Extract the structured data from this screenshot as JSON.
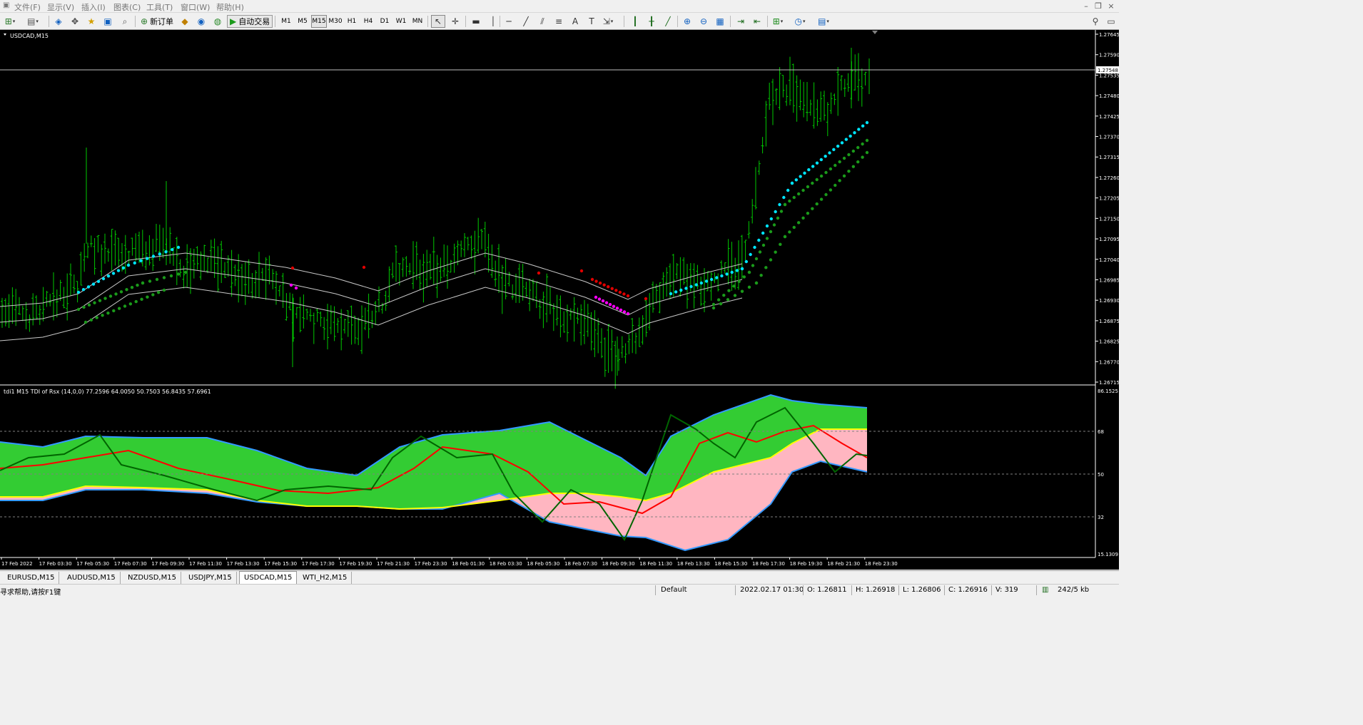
{
  "menu": {
    "items": [
      "文件(F)",
      "显示(V)",
      "图表(C)",
      "插入(I)",
      "工具(T)",
      "窗口(W)",
      "帮助(H)"
    ]
  },
  "toolbar": {
    "new_order_label": "新订单",
    "auto_trading_label": "自动交易",
    "timeframes": [
      "M1",
      "M5",
      "M15",
      "M30",
      "H1",
      "H4",
      "D1",
      "W1",
      "MN"
    ],
    "active_timeframe": "M15",
    "icons": {
      "new_chart": "new-chart-icon",
      "profiles": "profiles-icon",
      "market_watch": "market-watch-icon",
      "data_window": "data-window-icon",
      "navigator": "navigator-icon",
      "terminal": "terminal-icon",
      "tester": "strategy-tester-icon",
      "metaeditor": "metaeditor-icon",
      "signals": "signals-icon",
      "cursor": "cursor-icon",
      "crosshair": "crosshair-icon",
      "vertical_line": "vertical-line-icon",
      "horizontal_line": "horizontal-line-icon",
      "trendline": "trendline-icon",
      "channel": "equidistant-channel-icon",
      "fibonacci": "fibonacci-icon",
      "text": "text-icon",
      "text_label": "text-label-icon",
      "arrows": "arrows-icon",
      "bar_chart": "bar-chart-icon",
      "candles": "candlesticks-icon",
      "line_chart": "line-chart-icon",
      "zoom_in": "zoom-in-icon",
      "zoom_out": "zoom-out-icon",
      "tile": "tile-windows-icon",
      "autoscroll": "autoscroll-icon",
      "chart_shift": "chart-shift-icon",
      "indicators": "indicators-icon",
      "periods": "periods-icon",
      "templates": "templates-icon",
      "search": "search-icon",
      "chat": "chat-icon"
    }
  },
  "window": {
    "minimize": "–",
    "restore": "❐",
    "close": "×"
  },
  "chart": {
    "symbol_label": "USDCAD,M15",
    "indicator_label": "tdi1 M15 TDI of Rsx (14,0,0) 77.2596 64.0050 50.7503 56.8435 57.6961",
    "current_price_label": "1.27548",
    "price_axis": [
      "1.27645",
      "1.27590",
      "1.27535",
      "1.27480",
      "1.27425",
      "1.27370",
      "1.27315",
      "1.27260",
      "1.27205",
      "1.27150",
      "1.27095",
      "1.27040",
      "1.26985",
      "1.26930",
      "1.26875",
      "1.26825",
      "1.26770",
      "1.26715"
    ],
    "indicator_axis": [
      "86.1525",
      "68",
      "50",
      "32",
      "15.1309"
    ],
    "time_axis": [
      "17 Feb 2022",
      "17 Feb 03:30",
      "17 Feb 05:30",
      "17 Feb 07:30",
      "17 Feb 09:30",
      "17 Feb 11:30",
      "17 Feb 13:30",
      "17 Feb 15:30",
      "17 Feb 17:30",
      "17 Feb 19:30",
      "17 Feb 21:30",
      "17 Feb 23:30",
      "18 Feb 01:30",
      "18 Feb 03:30",
      "18 Feb 05:30",
      "18 Feb 07:30",
      "18 Feb 09:30",
      "18 Feb 11:30",
      "18 Feb 13:30",
      "18 Feb 15:30",
      "18 Feb 17:30",
      "18 Feb 19:30",
      "18 Feb 21:30",
      "18 Feb 23:30"
    ],
    "colors": {
      "background": "#000000",
      "bars": "#00c800",
      "band": "#c8c8c8",
      "dot_up": "#00e5ff",
      "dot_green": "#1a9a1a",
      "dot_down_red": "#e00000",
      "dot_down_magenta": "#ff00ff",
      "upper_fill": "#33cc33",
      "lower_fill": "#ffb6c1",
      "band_line": "#3399ff",
      "mid_line": "#ffff00",
      "signal_line": "#ff0000",
      "rsi_line": "#006400",
      "axis_text": "#ffffff"
    }
  },
  "tabs": [
    "EURUSD,M15",
    "AUDUSD,M15",
    "NZDUSD,M15",
    "USDJPY,M15",
    "USDCAD,M15",
    "WTI_H2,M15"
  ],
  "active_tab": "USDCAD,M15",
  "status": {
    "help": "寻求帮助,请按F1键",
    "profile": "Default",
    "datetime": "2022.02.17 01:30",
    "open": "O: 1.26811",
    "high": "H: 1.26918",
    "low": "L: 1.26806",
    "close": "C: 1.26916",
    "volume": "V: 319",
    "traffic": "242/5 kb"
  }
}
